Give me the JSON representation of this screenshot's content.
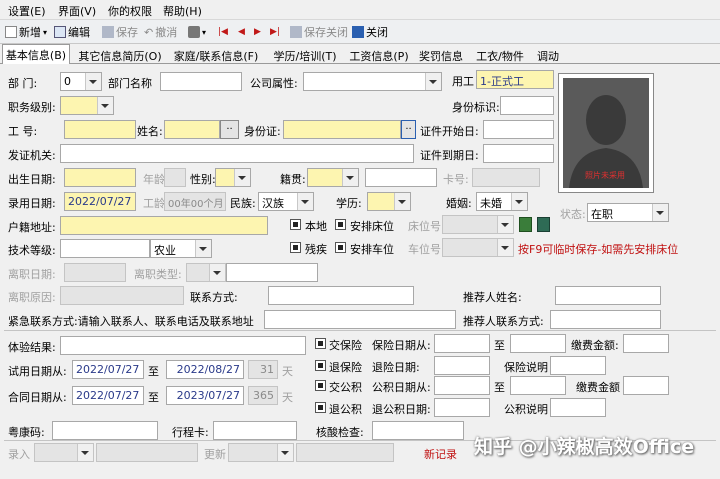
{
  "menu": [
    "设置(E)",
    "界面(V)",
    "你的权限",
    "帮助(H)"
  ],
  "toolbar": {
    "new": "新增",
    "edit": "编辑",
    "save": "保存",
    "undo": "撤消",
    "save_close": "保存关闭",
    "close": "关闭"
  },
  "tabs": [
    "基本信息(B)",
    "其它信息简历(O)",
    "家庭/联系信息(F)",
    "学历/培训(T)",
    "工资信息(P)",
    "奖罚信息",
    "工衣/物件",
    "调动"
  ],
  "form": {
    "dept_label": "部      门:",
    "dept_value": "0",
    "dept_name_label": "部门名称",
    "company_attr_label": "公司属性:",
    "employment_label": "用工",
    "employment_value": "1-正式工",
    "job_level_label": "职务级别:",
    "identity_label": "身份标识:",
    "job_no_label": "工       号:",
    "name_label": "姓名:",
    "idcard_label": "身份证:",
    "cert_start_label": "证件开始日:",
    "issuer_label": "发证机关:",
    "cert_end_label": "证件到期日:",
    "birth_label": "出生日期:",
    "age_label": "年龄",
    "gender_label": "性别:",
    "origin_label": "籍贯:",
    "card_label": "卡号:",
    "hire_label": "录用日期:",
    "hire_value": "2022/07/27",
    "seniority_label": "工龄",
    "seniority_value": "00年00个月",
    "ethnic_label": "民族:",
    "ethnic_value": "汉族",
    "edu_label": "学历:",
    "marital_label": "婚姻:",
    "marital_value": "未婚",
    "photo_caption": "照片未采用",
    "status_label": "状态:",
    "status_value": "在职",
    "hukou_label": "户籍地址:",
    "local_label": "本地",
    "bed_label": "安排床位",
    "bed_no_label": "床位号",
    "skill_label": "技术等级:",
    "hukou_type_value": "农业",
    "disabled_label": "残疾",
    "parking_label": "安排车位",
    "parking_no_label": "车位号",
    "hint": "按F9可临时保存-如需先安排床位",
    "leave_date_label": "离职日期:",
    "leave_type_label": "离职类型:",
    "leave_reason_label": "离职原因:",
    "contact_label": "联系方式:",
    "referrer_label": "推荐人姓名:",
    "emergency_label": "紧急联系方式:请输入联系人、联系电话及联系地址",
    "referrer_contact_label": "推荐人联系方式:",
    "exam_label": "体验结果:",
    "social_ins_label": "交保险",
    "ins_from_label": "保险日期从:",
    "to_label": "至",
    "fee_label": "缴费金额:",
    "probation_label": "试用日期从:",
    "prob_from": "2022/07/27",
    "prob_to": "2022/08/27",
    "prob_days": "31",
    "days_unit": "天",
    "withdraw_ins_label": "退保险",
    "withdraw_date_label": "退险日期:",
    "ins_note_label": "保险说明",
    "contract_label": "合同日期从:",
    "contract_from": "2022/07/27",
    "contract_to": "2023/07/27",
    "contract_days": "365",
    "fund_label": "交公积",
    "fund_from_label": "公积日期从:",
    "fund_fee_label": "缴费金额",
    "withdraw_fund_label": "退公积",
    "fund_withdraw_date_label": "退公积日期:",
    "fund_note_label": "公积说明",
    "health_label": "粤康码:",
    "trip_label": "行程卡:",
    "nucleic_label": "核酸检查:",
    "entry_label": "录入",
    "update_label": "更新",
    "new_record": "新记录",
    "watermark": "知乎 @小辣椒高效Office"
  }
}
